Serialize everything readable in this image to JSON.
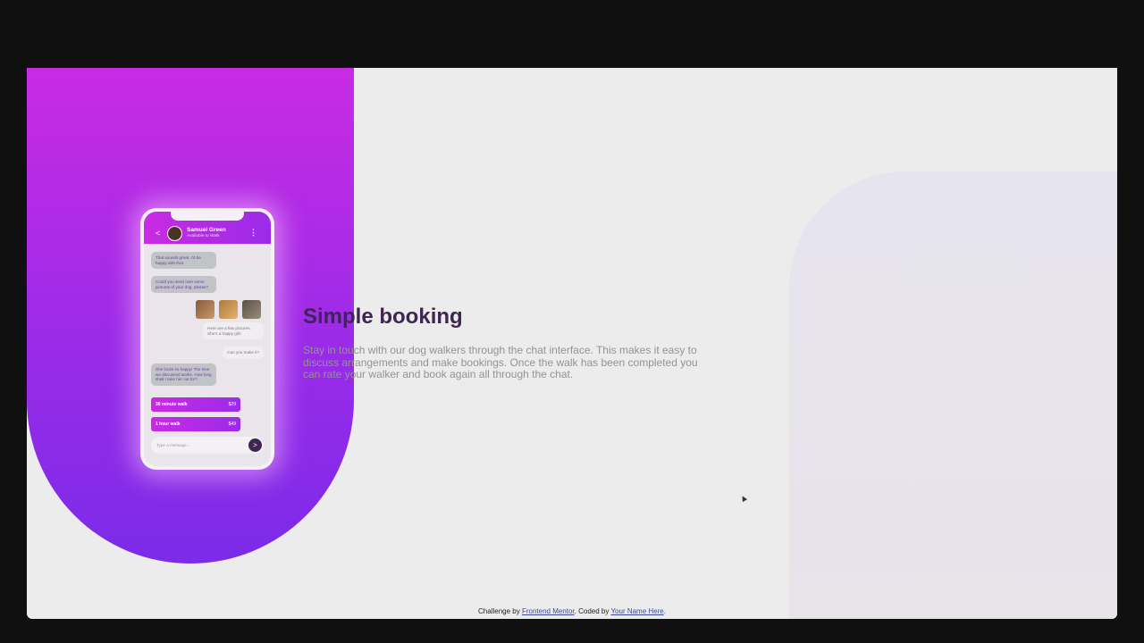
{
  "colors": {
    "accent_magenta": "#c92be3",
    "accent_violet": "#7b2be8",
    "dark_text": "#3e2653",
    "grey_text": "#939393"
  },
  "chat": {
    "back_glyph": "<",
    "contact_name": "Samuel Green",
    "contact_status": "Available to Walk",
    "menu_glyph": "⋮",
    "messages": [
      "That sounds great. I’d be happy with that.",
      "Could you send over some pictures of your dog, please?",
      "Here are a few pictures. She’s a happy girl!",
      "Can you make it?",
      "She looks so happy! The time we discussed works. How long shall I take her out for?"
    ],
    "options": [
      {
        "label": "30 minute walk",
        "price": "$29"
      },
      {
        "label": "1 hour walk",
        "price": "$49"
      }
    ],
    "input_placeholder": "Type a message…",
    "send_glyph": ">"
  },
  "main": {
    "title": "Simple booking",
    "description": "Stay in touch with our dog walkers through the chat interface. This makes it easy to discuss arrangements and make bookings. Once the walk has been completed you can rate your walker and book again all through the chat."
  },
  "footer": {
    "prefix": "Challenge by ",
    "link1": "Frontend Mentor",
    "middle": ". Coded by ",
    "link2": "Your Name Here",
    "suffix": "."
  }
}
